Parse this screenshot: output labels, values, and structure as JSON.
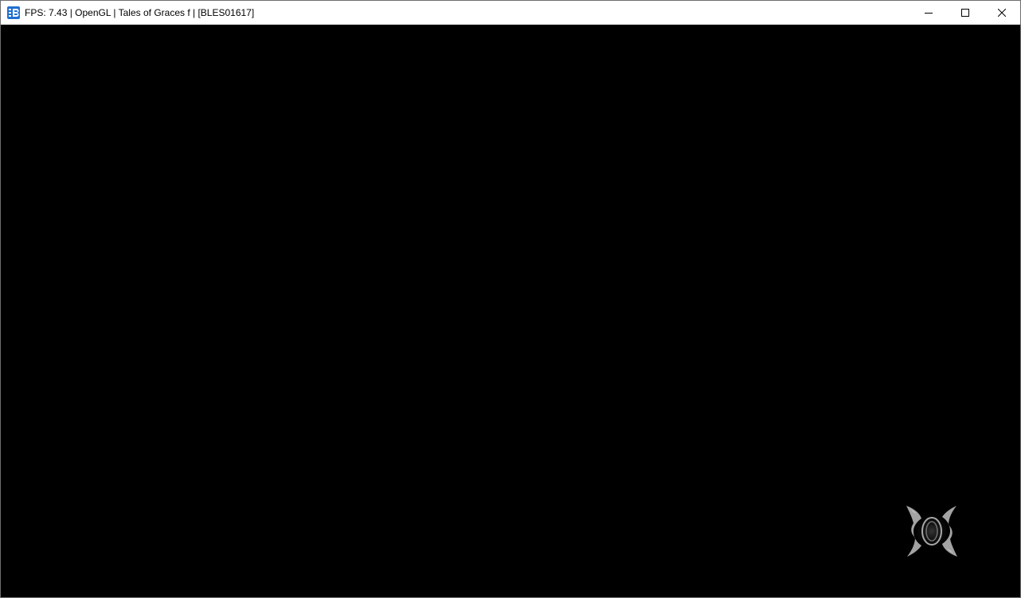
{
  "window": {
    "title": "FPS: 7.43 | OpenGL | Tales of Graces f | [BLES01617]",
    "app_icon": "rpcs3-icon",
    "controls": {
      "minimize": "minimize-icon",
      "maximize": "maximize-icon",
      "close": "close-icon"
    }
  },
  "game_view": {
    "background_color": "#000000",
    "loading_indicator": "loading-emblem-icon"
  },
  "colors": {
    "titlebar": "#ffffff",
    "icon_blue": "#1f6fd1",
    "emblem": "#bfbfbf"
  }
}
